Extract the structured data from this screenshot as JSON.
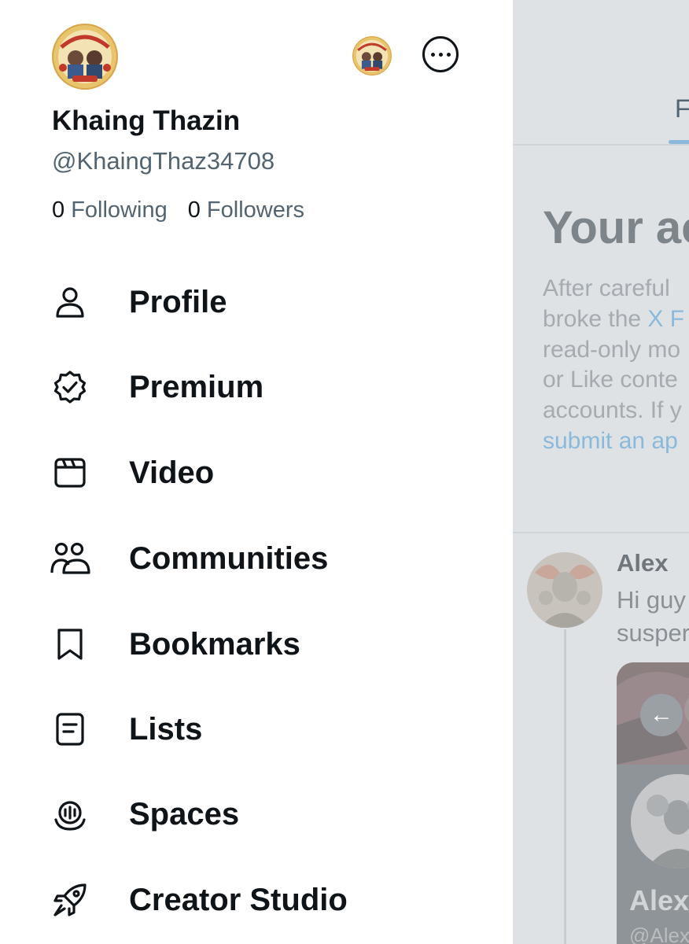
{
  "account": {
    "name": "Khaing Thazin",
    "handle": "@KhaingThaz34708",
    "following_count": "0",
    "following_label": "Following",
    "followers_count": "0",
    "followers_label": "Followers"
  },
  "nav": {
    "items": [
      {
        "label": "Profile",
        "icon": "person-icon"
      },
      {
        "label": "Premium",
        "icon": "verified-badge-icon"
      },
      {
        "label": "Video",
        "icon": "video-icon"
      },
      {
        "label": "Communities",
        "icon": "communities-icon"
      },
      {
        "label": "Bookmarks",
        "icon": "bookmark-icon"
      },
      {
        "label": "Lists",
        "icon": "list-icon"
      },
      {
        "label": "Spaces",
        "icon": "spaces-icon"
      },
      {
        "label": "Creator Studio",
        "icon": "rocket-icon"
      }
    ]
  },
  "background": {
    "tab_partial": "F",
    "notice_title": "Your ac",
    "notice_lines": [
      "After careful",
      "broke the ",
      "read-only mo",
      "or Like conte",
      "accounts. If y",
      "submit an ap"
    ],
    "notice_link": "X F",
    "post_author": "Alex",
    "post_lines": [
      "Hi guy",
      "susper"
    ],
    "card_name": "Alex",
    "card_handle": "@Alex"
  },
  "colors": {
    "text_primary": "#0f1419",
    "text_secondary": "#536471",
    "overlay_bg": "#dfe2e5",
    "link": "#8ab9db"
  }
}
